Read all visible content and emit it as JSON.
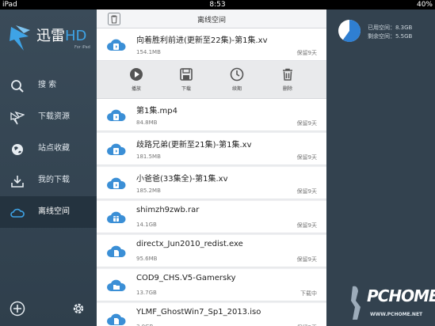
{
  "status_bar": {
    "device": "iPad",
    "time": "8:53",
    "battery": "40%"
  },
  "app": {
    "brand": "迅雷",
    "brand_hd": "HD",
    "brand_sub": "For iPad"
  },
  "sidebar": {
    "items": [
      {
        "label": "搜    索",
        "icon": "search-icon"
      },
      {
        "label": "下载资源",
        "icon": "bird-icon"
      },
      {
        "label": "站点收藏",
        "icon": "globe-icon"
      },
      {
        "label": "我的下载",
        "icon": "download-icon"
      },
      {
        "label": "离线空间",
        "icon": "cloud-icon",
        "active": true
      }
    ]
  },
  "storage": {
    "used": "已用空间：8.3GB",
    "free": "剩余空间：5.5GB",
    "used_fraction": 0.6
  },
  "panel": {
    "title": "离线空间"
  },
  "actions": [
    {
      "label": "播放",
      "icon": "play-icon"
    },
    {
      "label": "下载",
      "icon": "save-icon"
    },
    {
      "label": "续期",
      "icon": "clock-icon"
    },
    {
      "label": "删除",
      "icon": "trash-icon"
    }
  ],
  "files": [
    {
      "name": "向着胜利前进(更新至22集)-第1集.xv",
      "size": "154.1MB",
      "status": "保留9天",
      "type": "video"
    },
    {
      "name": "第1集.mp4",
      "size": "84.8MB",
      "status": "保留9天",
      "type": "video"
    },
    {
      "name": "歧路兄弟(更新至21集)-第1集.xv",
      "size": "181.5MB",
      "status": "保留9天",
      "type": "video"
    },
    {
      "name": "小爸爸(33集全)-第1集.xv",
      "size": "185.2MB",
      "status": "保留9天",
      "type": "video"
    },
    {
      "name": "shimzh9zwb.rar",
      "size": "14.1GB",
      "status": "保留9天",
      "type": "archive"
    },
    {
      "name": "directx_Jun2010_redist.exe",
      "size": "95.6MB",
      "status": "保留9天",
      "type": "file"
    },
    {
      "name": "COD9_CHS.V5-Gamersky",
      "size": "13.7GB",
      "status": "下载中",
      "type": "folder"
    },
    {
      "name": "YLMF_GhostWin7_Sp1_2013.iso",
      "size": "3.0GB",
      "status": "保留9天",
      "type": "file"
    }
  ],
  "watermark": {
    "text": "PCHOME",
    "url": "WWW.PCHOME.NET"
  },
  "colors": {
    "accent": "#3b8fd6",
    "sidebar": "#33424f",
    "panel": "#eeeff1"
  }
}
